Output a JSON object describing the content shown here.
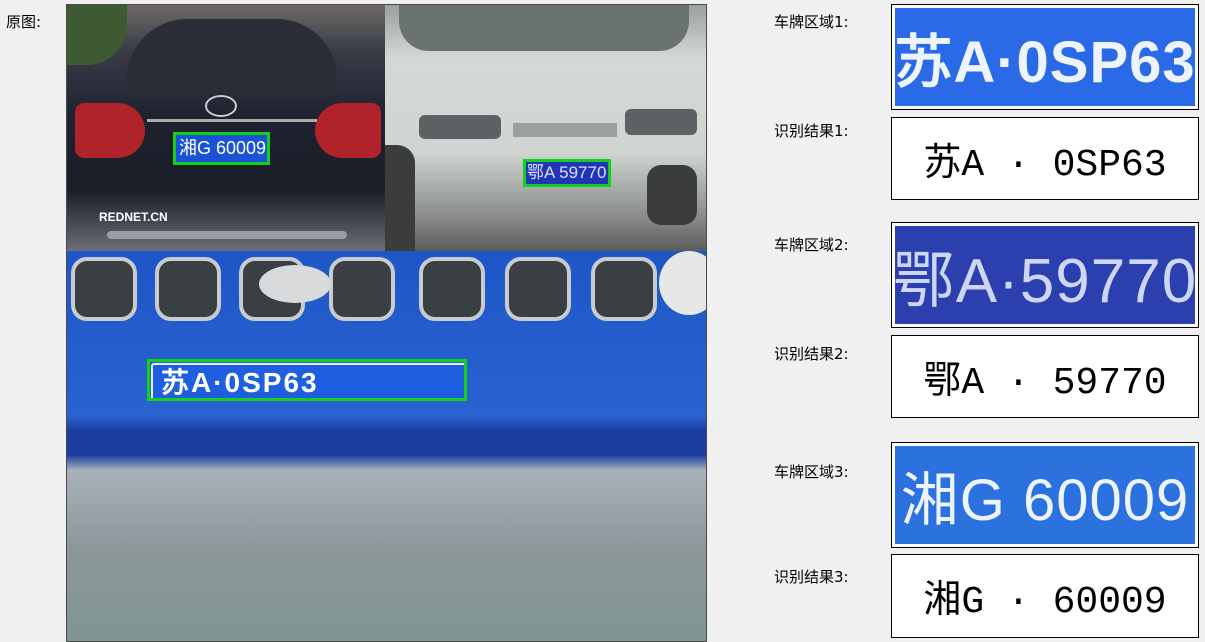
{
  "original_label": "原图:",
  "photo_plates": {
    "car1": "湘G 60009",
    "car2": "鄂A 59770",
    "car3": "苏A·0SP63"
  },
  "watermark": "REDNET.CN",
  "results": [
    {
      "region_label": "车牌区域1:",
      "plate_image_text": "苏A·0SP63",
      "result_label": "识别结果1:",
      "result_text": "苏A · 0SP63"
    },
    {
      "region_label": "车牌区域2:",
      "plate_image_text": "鄂A·59770",
      "result_label": "识别结果2:",
      "result_text": "鄂A · 59770"
    },
    {
      "region_label": "车牌区域3:",
      "plate_image_text": "湘G 60009",
      "result_label": "识别结果3:",
      "result_text": "湘G · 60009"
    }
  ]
}
